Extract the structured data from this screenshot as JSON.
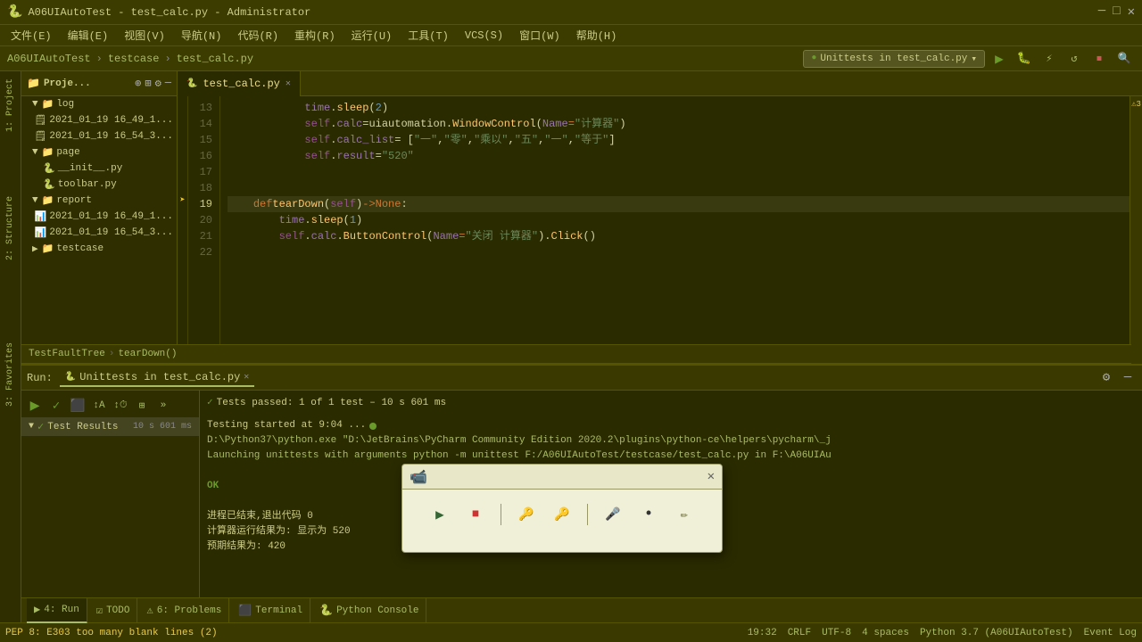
{
  "app": {
    "title": "A06UIAutoTest - test_calc.py - Administrator",
    "logo": "🐍"
  },
  "title_bar": {
    "title": "A06UIAutoTest - test_calc.py - Administrator",
    "min": "─",
    "max": "□",
    "close": "✕"
  },
  "menu": {
    "items": [
      "文件(E)",
      "编辑(E)",
      "视图(V)",
      "导航(N)",
      "代码(R)",
      "重构(R)",
      "运行(U)",
      "工具(T)",
      "VCS(S)",
      "窗口(W)",
      "帮助(H)"
    ]
  },
  "nav": {
    "breadcrumb1": "A06UIAutoTest",
    "breadcrumb2": "testcase",
    "breadcrumb3": "test_calc.py",
    "run_config": "Unittests in test_calc.py",
    "run_icon": "▶",
    "debug_icon": "🐛",
    "reload_icon": "↺",
    "stop_icon": "⏹",
    "search_icon": "🔍"
  },
  "project_panel": {
    "title": "Proje...",
    "expand_icon": "⊕",
    "layout_icon": "⊞",
    "settings_icon": "⚙",
    "minimize_icon": "─",
    "tree": [
      {
        "label": "log",
        "type": "folder",
        "indent": 0,
        "expanded": true
      },
      {
        "label": "2021_01_19 16_49_1...",
        "type": "file",
        "indent": 1
      },
      {
        "label": "2021_01_19 16_54_3...",
        "type": "file",
        "indent": 1
      },
      {
        "label": "page",
        "type": "folder",
        "indent": 0,
        "expanded": true
      },
      {
        "label": "__init__.py",
        "type": "python",
        "indent": 1
      },
      {
        "label": "toolbar.py",
        "type": "python",
        "indent": 1
      },
      {
        "label": "report",
        "type": "folder",
        "indent": 0,
        "expanded": true
      },
      {
        "label": "2021_01_19 16_49_1...",
        "type": "report",
        "indent": 1
      },
      {
        "label": "2021_01_19 16_54_3...",
        "type": "report",
        "indent": 1
      },
      {
        "label": "testcase",
        "type": "folder",
        "indent": 0,
        "expanded": false
      }
    ]
  },
  "editor": {
    "tab_label": "test_calc.py",
    "warning_count": "3",
    "lines": [
      {
        "num": 13,
        "content": "            time.sleep(2)",
        "active": false
      },
      {
        "num": 14,
        "content": "            self.calc = uiautomation.WindowControl(Name=\"计算器\")",
        "active": false
      },
      {
        "num": 15,
        "content": "            self.calc_list = [\"一\", \"零\", \"乘以\", \"五\", \"一\", \"等于\"]",
        "active": false
      },
      {
        "num": 16,
        "content": "            self.result = \"520\"",
        "active": false
      },
      {
        "num": 17,
        "content": "",
        "active": false
      },
      {
        "num": 18,
        "content": "",
        "active": false
      },
      {
        "num": 19,
        "content": "    def tearDown(self) -> None:",
        "active": true,
        "breakpoint": true,
        "debug": true
      },
      {
        "num": 20,
        "content": "        time.sleep(1)",
        "active": false
      },
      {
        "num": 21,
        "content": "        self.calc.ButtonControl(Name=\"关闭 计算器\").Click()",
        "active": false
      },
      {
        "num": 22,
        "content": "",
        "active": false
      }
    ]
  },
  "breadcrumb_footer": {
    "part1": "TestFaultTree",
    "part2": "tearDown()"
  },
  "run_panel": {
    "tab_label": "Unittests in test_calc.py",
    "pass_status": "Tests passed: 1 of 1 test – 10 s 601 ms",
    "test_result_label": "Test Results",
    "test_result_time": "10 s 601 ms",
    "output_lines": [
      "Testing started at 9:04 ...",
      "D:\\Python37\\python.exe \"D:\\JetBrains\\PyCharm Community Edition 2020.2\\plugins\\python-ce\\helpers\\pycharm\\_j",
      "Launching unittests with arguments python -m unittest F:/A06UIAutoTest/testcase/test_calc.py in F:\\A06UIAu",
      "",
      "OK",
      "",
      "进程已结束,退出代码 0",
      "计算器运行结果为:  显示为 520",
      "预期结果为:  420"
    ]
  },
  "bottom_tabs": [
    {
      "label": "4: Run",
      "icon": "▶"
    },
    {
      "label": "TODO",
      "icon": "☑"
    },
    {
      "label": "6: Problems",
      "icon": "⚠"
    },
    {
      "label": "Terminal",
      "icon": "⬛"
    },
    {
      "label": "Python Console",
      "icon": "🐍"
    }
  ],
  "status_bar": {
    "warning": "PEP 8: E303 too many blank lines (2)",
    "line_col": "19:32",
    "crlf": "CRLF",
    "encoding": "UTF-8",
    "indent": "4 spaces",
    "python": "Python 3.7 (A06UIAutoTest)",
    "event_log": "Event Log"
  },
  "video_popup": {
    "close": "✕",
    "play_label": "▶",
    "stop_label": "⏹",
    "key1_label": "🔑",
    "key2_label": "🔑",
    "mic_label": "🎤",
    "dot_label": "•",
    "edit_label": "✏"
  },
  "sidebar_tabs": {
    "project": "1: Project",
    "structure": "2: Structure",
    "favorites": "3: Favorites"
  }
}
